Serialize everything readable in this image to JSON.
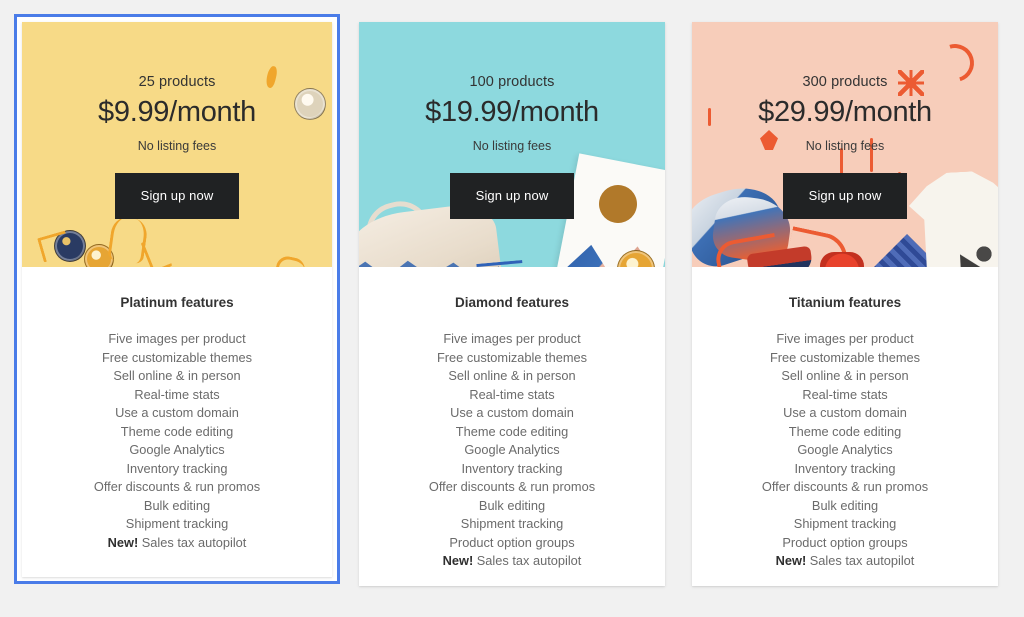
{
  "page": {
    "background_color": "#f1f1f1",
    "selected_plan_index": 0,
    "selection_border_color": "#4a7ce8"
  },
  "plans": [
    {
      "id": "platinum",
      "products_label": "25 products",
      "price": "$9.99/month",
      "subnote": "No listing fees",
      "cta_label": "Sign up now",
      "hero_color": "#f7da87",
      "features_title": "Platinum features",
      "features": [
        {
          "text": "Five images per product",
          "badge": ""
        },
        {
          "text": "Free customizable themes",
          "badge": ""
        },
        {
          "text": "Sell online & in person",
          "badge": ""
        },
        {
          "text": "Real-time stats",
          "badge": ""
        },
        {
          "text": "Use a custom domain",
          "badge": ""
        },
        {
          "text": "Theme code editing",
          "badge": ""
        },
        {
          "text": "Google Analytics",
          "badge": ""
        },
        {
          "text": "Inventory tracking",
          "badge": ""
        },
        {
          "text": "Offer discounts & run promos",
          "badge": ""
        },
        {
          "text": "Bulk editing",
          "badge": ""
        },
        {
          "text": "Shipment tracking",
          "badge": ""
        },
        {
          "text": "Sales tax autopilot",
          "badge": "New!"
        }
      ]
    },
    {
      "id": "diamond",
      "products_label": "100 products",
      "price": "$19.99/month",
      "subnote": "No listing fees",
      "cta_label": "Sign up now",
      "hero_color": "#8dd9de",
      "features_title": "Diamond features",
      "features": [
        {
          "text": "Five images per product",
          "badge": ""
        },
        {
          "text": "Free customizable themes",
          "badge": ""
        },
        {
          "text": "Sell online & in person",
          "badge": ""
        },
        {
          "text": "Real-time stats",
          "badge": ""
        },
        {
          "text": "Use a custom domain",
          "badge": ""
        },
        {
          "text": "Theme code editing",
          "badge": ""
        },
        {
          "text": "Google Analytics",
          "badge": ""
        },
        {
          "text": "Inventory tracking",
          "badge": ""
        },
        {
          "text": "Offer discounts & run promos",
          "badge": ""
        },
        {
          "text": "Bulk editing",
          "badge": ""
        },
        {
          "text": "Shipment tracking",
          "badge": ""
        },
        {
          "text": "Product option groups",
          "badge": ""
        },
        {
          "text": "Sales tax autopilot",
          "badge": "New!"
        }
      ]
    },
    {
      "id": "titanium",
      "products_label": "300 products",
      "price": "$29.99/month",
      "subnote": "No listing fees",
      "cta_label": "Sign up now",
      "hero_color": "#f7cdba",
      "features_title": "Titanium features",
      "features": [
        {
          "text": "Five images per product",
          "badge": ""
        },
        {
          "text": "Free customizable themes",
          "badge": ""
        },
        {
          "text": "Sell online & in person",
          "badge": ""
        },
        {
          "text": "Real-time stats",
          "badge": ""
        },
        {
          "text": "Use a custom domain",
          "badge": ""
        },
        {
          "text": "Theme code editing",
          "badge": ""
        },
        {
          "text": "Google Analytics",
          "badge": ""
        },
        {
          "text": "Inventory tracking",
          "badge": ""
        },
        {
          "text": "Offer discounts & run promos",
          "badge": ""
        },
        {
          "text": "Bulk editing",
          "badge": ""
        },
        {
          "text": "Shipment tracking",
          "badge": ""
        },
        {
          "text": "Product option groups",
          "badge": ""
        },
        {
          "text": "Sales tax autopilot",
          "badge": "New!"
        }
      ]
    }
  ]
}
